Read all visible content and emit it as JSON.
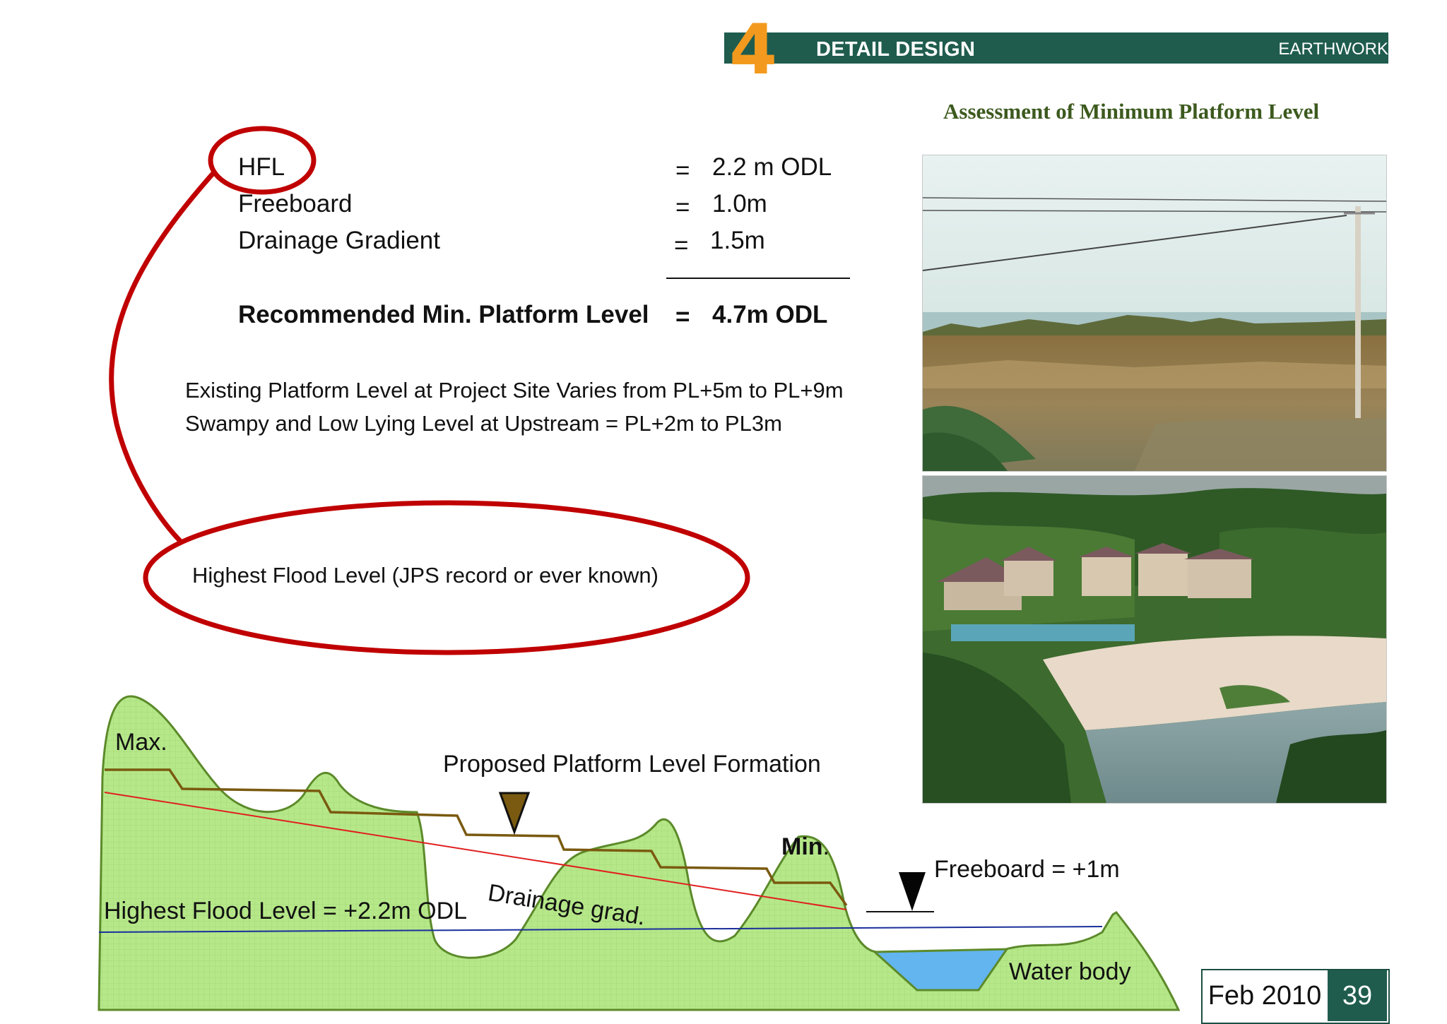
{
  "header": {
    "chapter_number": "4",
    "title": "DETAIL DESIGN",
    "section": "EARTHWORK"
  },
  "subtitle": "Assessment of  Minimum Platform Level",
  "parameters": [
    {
      "name": "HFL",
      "equals": "=",
      "value": "2.2 m ODL"
    },
    {
      "name": "Freeboard",
      "equals": "=",
      "value": "1.0m"
    },
    {
      "name": "Drainage Gradient",
      "equals": "=",
      "value": "1.5m"
    }
  ],
  "recommended": {
    "label": "Recommended Min. Platform Level",
    "equals": "=",
    "value": "4.7m ODL"
  },
  "notes": [
    "Existing Platform Level at Project Site Varies from PL+5m to PL+9m",
    "Swampy and Low Lying Level at Upstream = PL+2m to PL3m"
  ],
  "callout_text": "Highest Flood Level (JPS record or ever known)",
  "diagram": {
    "max_label": "Max.",
    "min_label": "Min",
    "min_dot": ".",
    "proposed_label": "Proposed Platform Level Formation",
    "drainage_label": "Drainage grad.",
    "hfl_label": "Highest Flood Level = +2.2m ODL",
    "freeboard_label": "Freeboard = +1m",
    "water_label": "Water body"
  },
  "colors": {
    "header_bar": "#1f5c4e",
    "accent_orange": "#f39a1e",
    "callout_red": "#c00000",
    "ground_fill": "#b6e88a",
    "ground_stroke": "#5c8a2a",
    "platform_line": "#7a5a10",
    "drainage_line": "#e02020",
    "flood_line": "#1a2f9a",
    "water": "#63b5f0"
  },
  "footer": {
    "date": "Feb 2010",
    "page": "39"
  }
}
